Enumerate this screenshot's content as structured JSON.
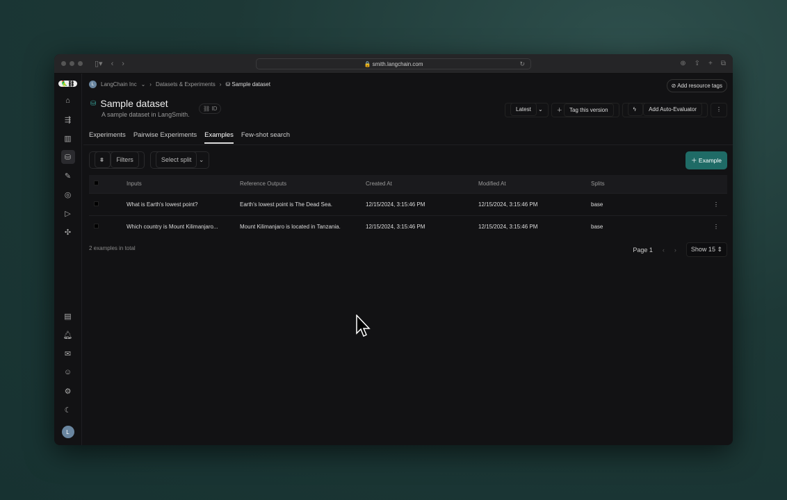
{
  "browser": {
    "url": "smith.langchain.com"
  },
  "breadcrumb": {
    "org": "LangChain Inc",
    "org_initial": "L",
    "section": "Datasets & Experiments",
    "current": "Sample dataset"
  },
  "header": {
    "title": "Sample dataset",
    "subtitle": "A sample dataset in LangSmith.",
    "id_label": "ID",
    "add_tags": "Add resource tags",
    "version": "Latest",
    "tag_version": "Tag this version",
    "auto_eval": "Add Auto-Evaluator"
  },
  "tabs": [
    "Experiments",
    "Pairwise Experiments",
    "Examples",
    "Few-shot search"
  ],
  "active_tab": "Examples",
  "toolbar": {
    "filters": "Filters",
    "split": "Select split",
    "add_example": "Example"
  },
  "table": {
    "columns": [
      "Inputs",
      "Reference Outputs",
      "Created At",
      "Modified At",
      "Splits"
    ],
    "rows": [
      {
        "input": "What is Earth's lowest point?",
        "output": "Earth's lowest point is The Dead Sea.",
        "created": "12/15/2024, 3:15:46 PM",
        "modified": "12/15/2024, 3:15:46 PM",
        "split": "base"
      },
      {
        "input": "Which country is Mount Kilimanjaro...",
        "output": "Mount Kilimanjaro is located in Tanzania.",
        "created": "12/15/2024, 3:15:46 PM",
        "modified": "12/15/2024, 3:15:46 PM",
        "split": "base"
      }
    ]
  },
  "footer": {
    "total": "2 examples in total",
    "page": "Page 1",
    "show": "Show 15"
  },
  "user": {
    "initial": "L"
  },
  "colors": {
    "accent": "#1f6b66"
  }
}
